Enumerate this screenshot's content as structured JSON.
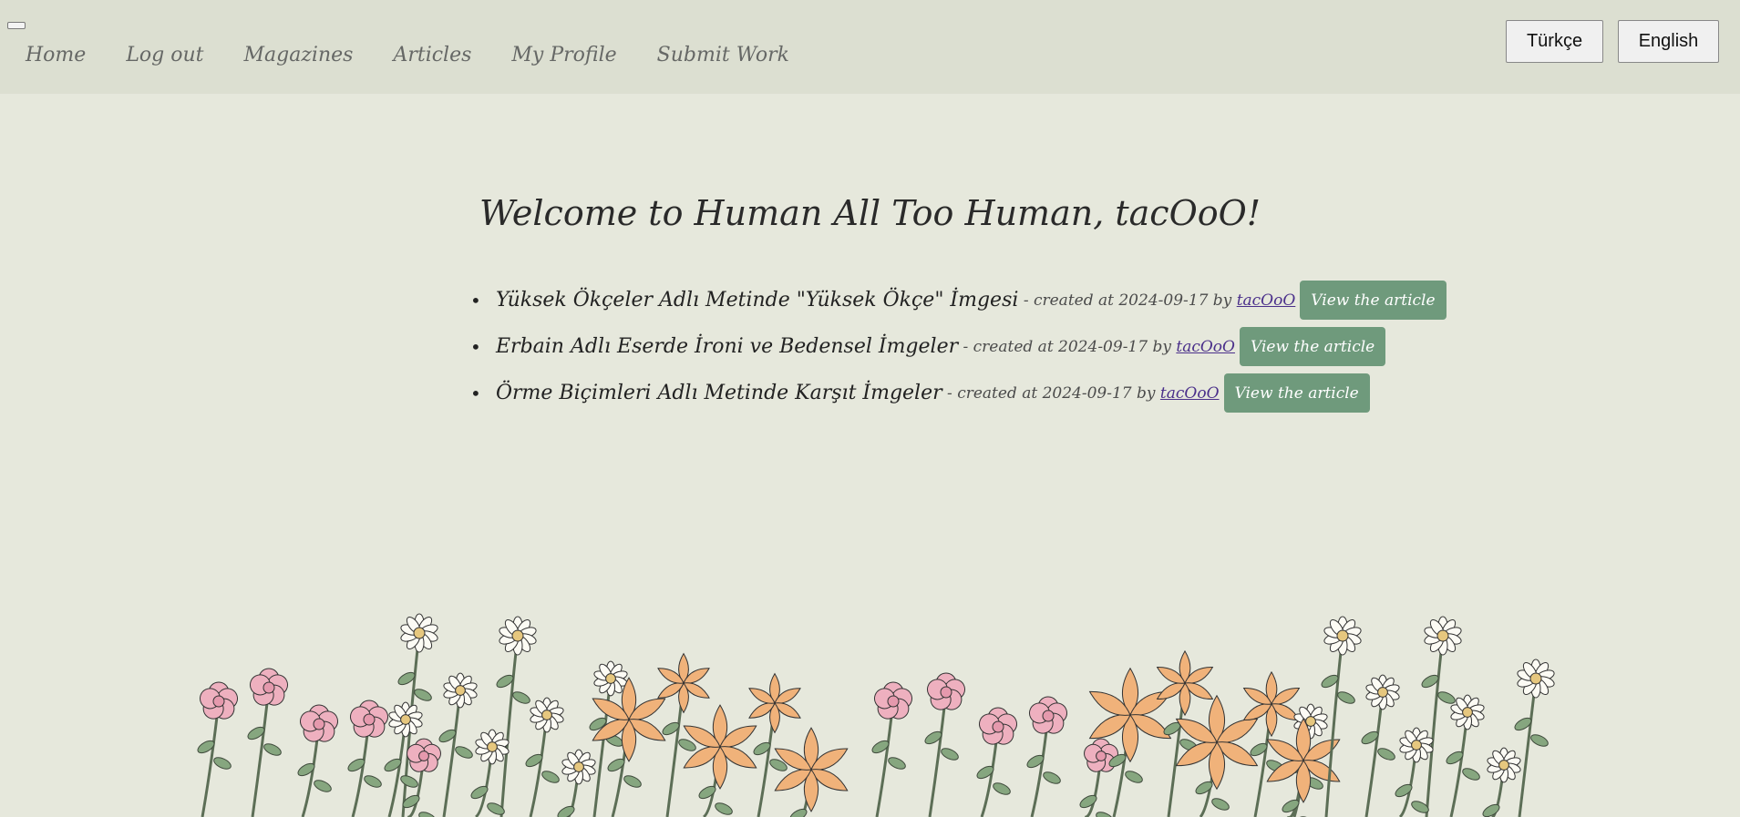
{
  "nav": {
    "links": [
      "Home",
      "Log out",
      "Magazines",
      "Articles",
      "My Profile",
      "Submit Work"
    ],
    "lang_tr": "Türkçe",
    "lang_en": "English"
  },
  "welcome_text": "Welcome to Human All Too Human, tacOoO!",
  "articles": [
    {
      "title": "Yüksek Ökçeler Adlı Metinde \"Yüksek Ökçe\" İmgesi",
      "meta": " - created at 2024-09-17 by ",
      "author": "tacOoO",
      "button": "View the article"
    },
    {
      "title": "Erbain Adlı Eserde İroni ve Bedensel İmgeler",
      "meta": " - created at 2024-09-17 by ",
      "author": "tacOoO",
      "button": "View the article"
    },
    {
      "title": "Örme Biçimleri Adlı Metinde Karşıt İmgeler",
      "meta": " - created at 2024-09-17 by ",
      "author": "tacOoO",
      "button": "View the article"
    }
  ],
  "colors": {
    "background": "#e6e8dc",
    "navbar": "#dcdfd1",
    "button": "#6f9a7c",
    "pink_flower": "#eeb0bf",
    "orange_lily": "#f0b27a",
    "white_daisy": "#fcfbf4",
    "leaf": "#86a67f"
  },
  "decoration": "flower-border-illustration"
}
